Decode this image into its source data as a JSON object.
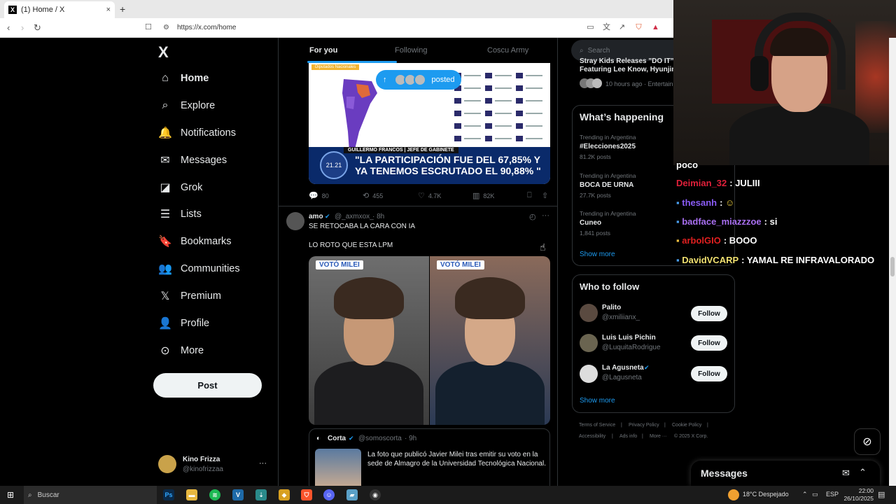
{
  "browser": {
    "tab_title": "(1) Home / X",
    "tab_favicon": "X",
    "tab_close": "×",
    "new_tab": "+",
    "url": "https://x.com/home"
  },
  "nav": {
    "logo": "X",
    "items": [
      {
        "label": "Home",
        "icon": "home-icon",
        "glyph": "⌂"
      },
      {
        "label": "Explore",
        "icon": "search-icon",
        "glyph": "⌕"
      },
      {
        "label": "Notifications",
        "icon": "bell-icon",
        "glyph": "🔔"
      },
      {
        "label": "Messages",
        "icon": "envelope-icon",
        "glyph": "✉"
      },
      {
        "label": "Grok",
        "icon": "grok-icon",
        "glyph": "◪"
      },
      {
        "label": "Lists",
        "icon": "list-icon",
        "glyph": "☰"
      },
      {
        "label": "Bookmarks",
        "icon": "bookmark-icon",
        "glyph": "🔖"
      },
      {
        "label": "Communities",
        "icon": "people-icon",
        "glyph": "👥"
      },
      {
        "label": "Premium",
        "icon": "x-premium-icon",
        "glyph": "𝕏"
      },
      {
        "label": "Profile",
        "icon": "person-icon",
        "glyph": "👤"
      },
      {
        "label": "More",
        "icon": "more-circle-icon",
        "glyph": "⊙"
      }
    ],
    "post_button": "Post",
    "account": {
      "name": "Kino Frizza",
      "handle": "@kinofrizzaa",
      "menu": "···"
    }
  },
  "feed": {
    "tabs": [
      "For you",
      "Following",
      "Coscu Army"
    ],
    "posted_pill": "posted",
    "tweet1": {
      "image_chyron_top": "GUILLERMO FRANCOS | JEFE DE GABINETE",
      "image_chyron_line1": "\"LA PARTICIPACIÓN FUE DEL 67,85% Y",
      "image_chyron_line2": "YA TENEMOS ESCRUTADO EL 90,88% \"",
      "image_badge": "21.21",
      "image_header": "Diputados Nacionales",
      "replies": "80",
      "reposts": "455",
      "likes": "4.7K",
      "views": "82K"
    },
    "tweet2": {
      "name": "amo",
      "handle": "@_axmxox_",
      "time": "· 8h",
      "text1": "SE RETOCABA LA CARA CON IA",
      "text2": "LO ROTO QUE ESTA LPM",
      "photo_tag_left": "VOTÓ MILEI",
      "photo_tag_right": "VOTÓ MILEI",
      "menu": "···",
      "quote": {
        "name": "Corta",
        "handle": "@somoscorta",
        "time": "· 9h",
        "text": "La foto que publicó Javier Milei tras emitir su voto en la sede de Almagro de la Universidad Tecnológica Nacional."
      }
    }
  },
  "right": {
    "search_placeholder": "Search",
    "top_news": {
      "title1": "Stray Kids Releases \"DO IT\"",
      "title2": "Featuring Lee Know, Hyunjin",
      "meta": "10 hours ago · Entertainm"
    },
    "whats_happening": {
      "title": "What’s happening",
      "trends": [
        {
          "meta": "Trending in Argentina",
          "name": "#Elecciones2025",
          "posts": "81.2K posts"
        },
        {
          "meta": "Trending in Argentina",
          "name": "BOCA DE URNA",
          "posts": "27.7K posts"
        },
        {
          "meta": "Trending in Argentina",
          "name": "Cuneo",
          "posts": "1,841 posts"
        }
      ],
      "show_more": "Show more"
    },
    "who_to_follow": {
      "title": "Who to follow",
      "accounts": [
        {
          "name": "Palito",
          "handle": "@xmiliianx_",
          "button": "Follow"
        },
        {
          "name": "Luis Luis Pichin",
          "handle": "@LuquitaRodrigue",
          "button": "Follow"
        },
        {
          "name": "La Agusneta",
          "handle": "@Lagusneta",
          "button": "Follow"
        }
      ],
      "show_more": "Show more"
    },
    "footer": [
      "Terms of Service",
      "|",
      "Privacy Policy",
      "|",
      "Cookie Policy",
      "|",
      "Accessibility",
      "|",
      "Ads info",
      "|",
      "More ···",
      "© 2025 X Corp."
    ]
  },
  "chat": [
    {
      "user": "",
      "msg": "poco",
      "color": "#ffffff"
    },
    {
      "user": "Deimian_32",
      "msg": ": JULIII",
      "color": "#e0203a"
    },
    {
      "user": "thesanh",
      "msg": ":",
      "color": "#8a5cf6"
    },
    {
      "user": "badface_miazzzoe",
      "msg": ": si",
      "color": "#a86ff0"
    },
    {
      "user": "arbolGIO",
      "msg": ": BOOO",
      "color": "#e02020"
    },
    {
      "user": "DavidVCARP",
      "msg": ": YAMAL RE INFRAVALORADO",
      "color": "#f0e070"
    }
  ],
  "messages_drawer": {
    "title": "Messages"
  },
  "taskbar": {
    "search": "Buscar",
    "weather": "18°C  Despejado",
    "lang": "ESP",
    "time": "22:00",
    "date": "26/10/2025"
  },
  "colors": {
    "accent": "#1d9bf0",
    "bg": "#000000",
    "border": "#2f3336",
    "muted": "#71767b"
  }
}
